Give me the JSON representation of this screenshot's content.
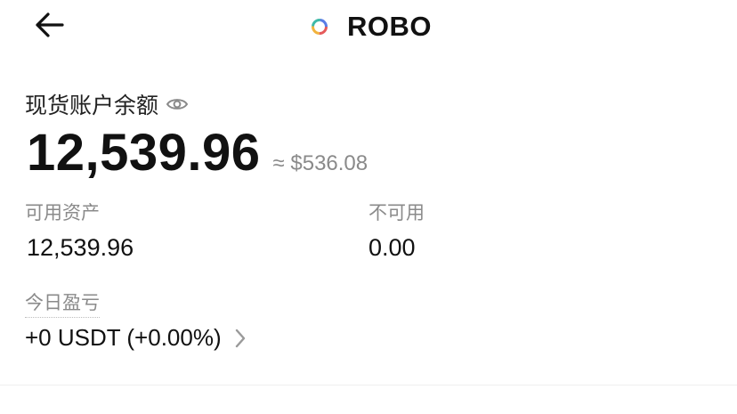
{
  "header": {
    "title": "ROBO",
    "back_icon": "arrow-left-icon",
    "coin_icon": "robo-coin-logo"
  },
  "balance": {
    "label": "现货账户余额",
    "value": "12,539.96",
    "approx_usd": "≈ $536.08",
    "eye_icon": "eye-icon"
  },
  "available": {
    "label": "可用资产",
    "value": "12,539.96"
  },
  "unavailable": {
    "label": "不可用",
    "value": "0.00"
  },
  "pnl": {
    "label": "今日盈亏",
    "value": "+0 USDT (+0.00%)",
    "chevron_icon": "chevron-right-icon"
  },
  "colors": {
    "text_primary": "#111111",
    "text_secondary": "#8a8a8a",
    "background": "#ffffff"
  }
}
